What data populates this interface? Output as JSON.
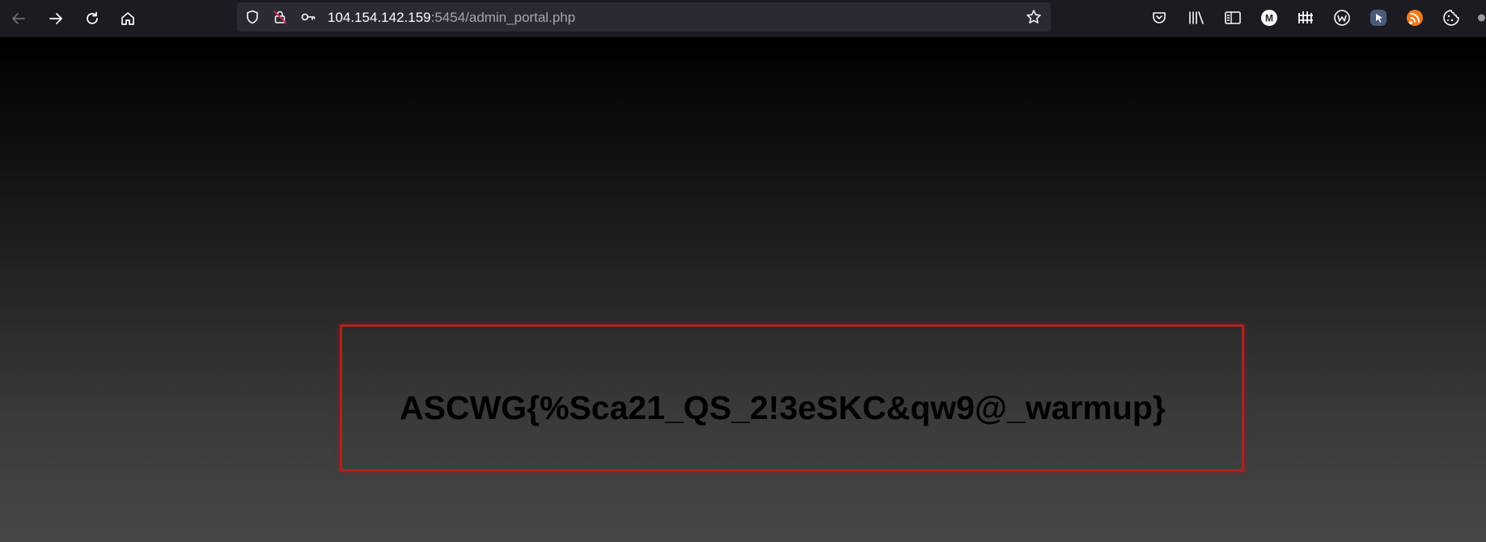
{
  "browser": {
    "nav": {
      "back_icon": "arrow-left-icon",
      "forward_icon": "arrow-right-icon",
      "reload_icon": "reload-icon",
      "home_icon": "home-icon"
    },
    "urlbar": {
      "host": "104.154.142.159",
      "rest": ":5454/admin_portal.php",
      "shield_icon": "shield-icon",
      "insecure_icon": "insecure-lock-icon",
      "permissions_icon": "key-icon",
      "bookmark_icon": "star-icon"
    },
    "toolbar_icons": [
      "pocket-icon",
      "library-icon",
      "sidebar-icon",
      "m-extension-icon",
      "fence-extension-icon",
      "w-extension-icon",
      "cursor-extension-icon",
      "rss-extension-icon",
      "cookie-extension-icon"
    ]
  },
  "page": {
    "flag": "ASCWG{%Sca21_QS_2!3eSKC&qw9@_warmup}"
  },
  "colors": {
    "toolbar_bg": "#1c1b22",
    "urlbar_bg": "#2b2a33",
    "box_border": "#b3201f"
  }
}
